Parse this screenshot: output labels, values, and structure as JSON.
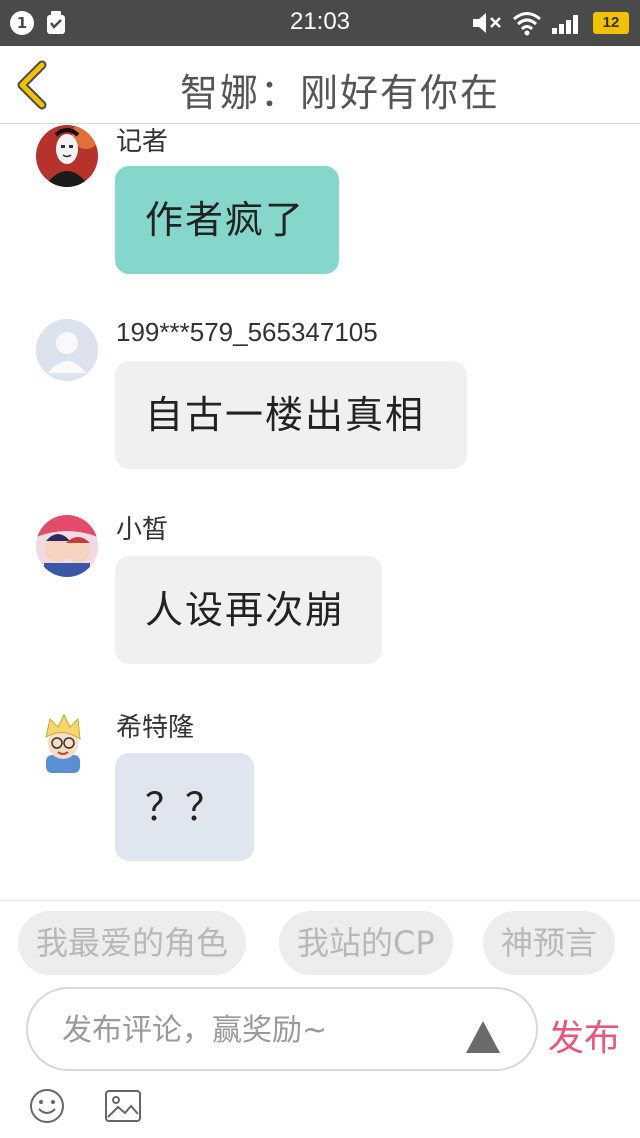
{
  "status_bar": {
    "notification_count": "1",
    "time": "21:03",
    "battery": "12"
  },
  "header": {
    "title": "智娜：刚好有你在",
    "back_icon": "chevron-left-icon"
  },
  "messages": [
    {
      "username": "记者",
      "text": "作者疯了",
      "bubble_color": "#85d6cb",
      "avatar": "masked-character-avatar"
    },
    {
      "username": "199***579_565347105",
      "text": "自古一楼出真相",
      "bubble_color": "#f0f0f0",
      "avatar": "default-user-avatar"
    },
    {
      "username": "小皙",
      "text": "人设再次崩",
      "bubble_color": "#f0f0f0",
      "avatar": "anime-couple-avatar"
    },
    {
      "username": "希特隆",
      "text": "？？",
      "bubble_color": "#e0e6ef",
      "avatar": "blonde-glasses-boy-avatar"
    }
  ],
  "quick_tags": [
    "我最爱的角色",
    "我站的CP",
    "神预言"
  ],
  "composer": {
    "placeholder": "发布评论，赢奖励~",
    "publish_label": "发布",
    "publish_color": "#e8577c"
  },
  "toolbar_icons": [
    "emoji-icon",
    "image-icon"
  ]
}
